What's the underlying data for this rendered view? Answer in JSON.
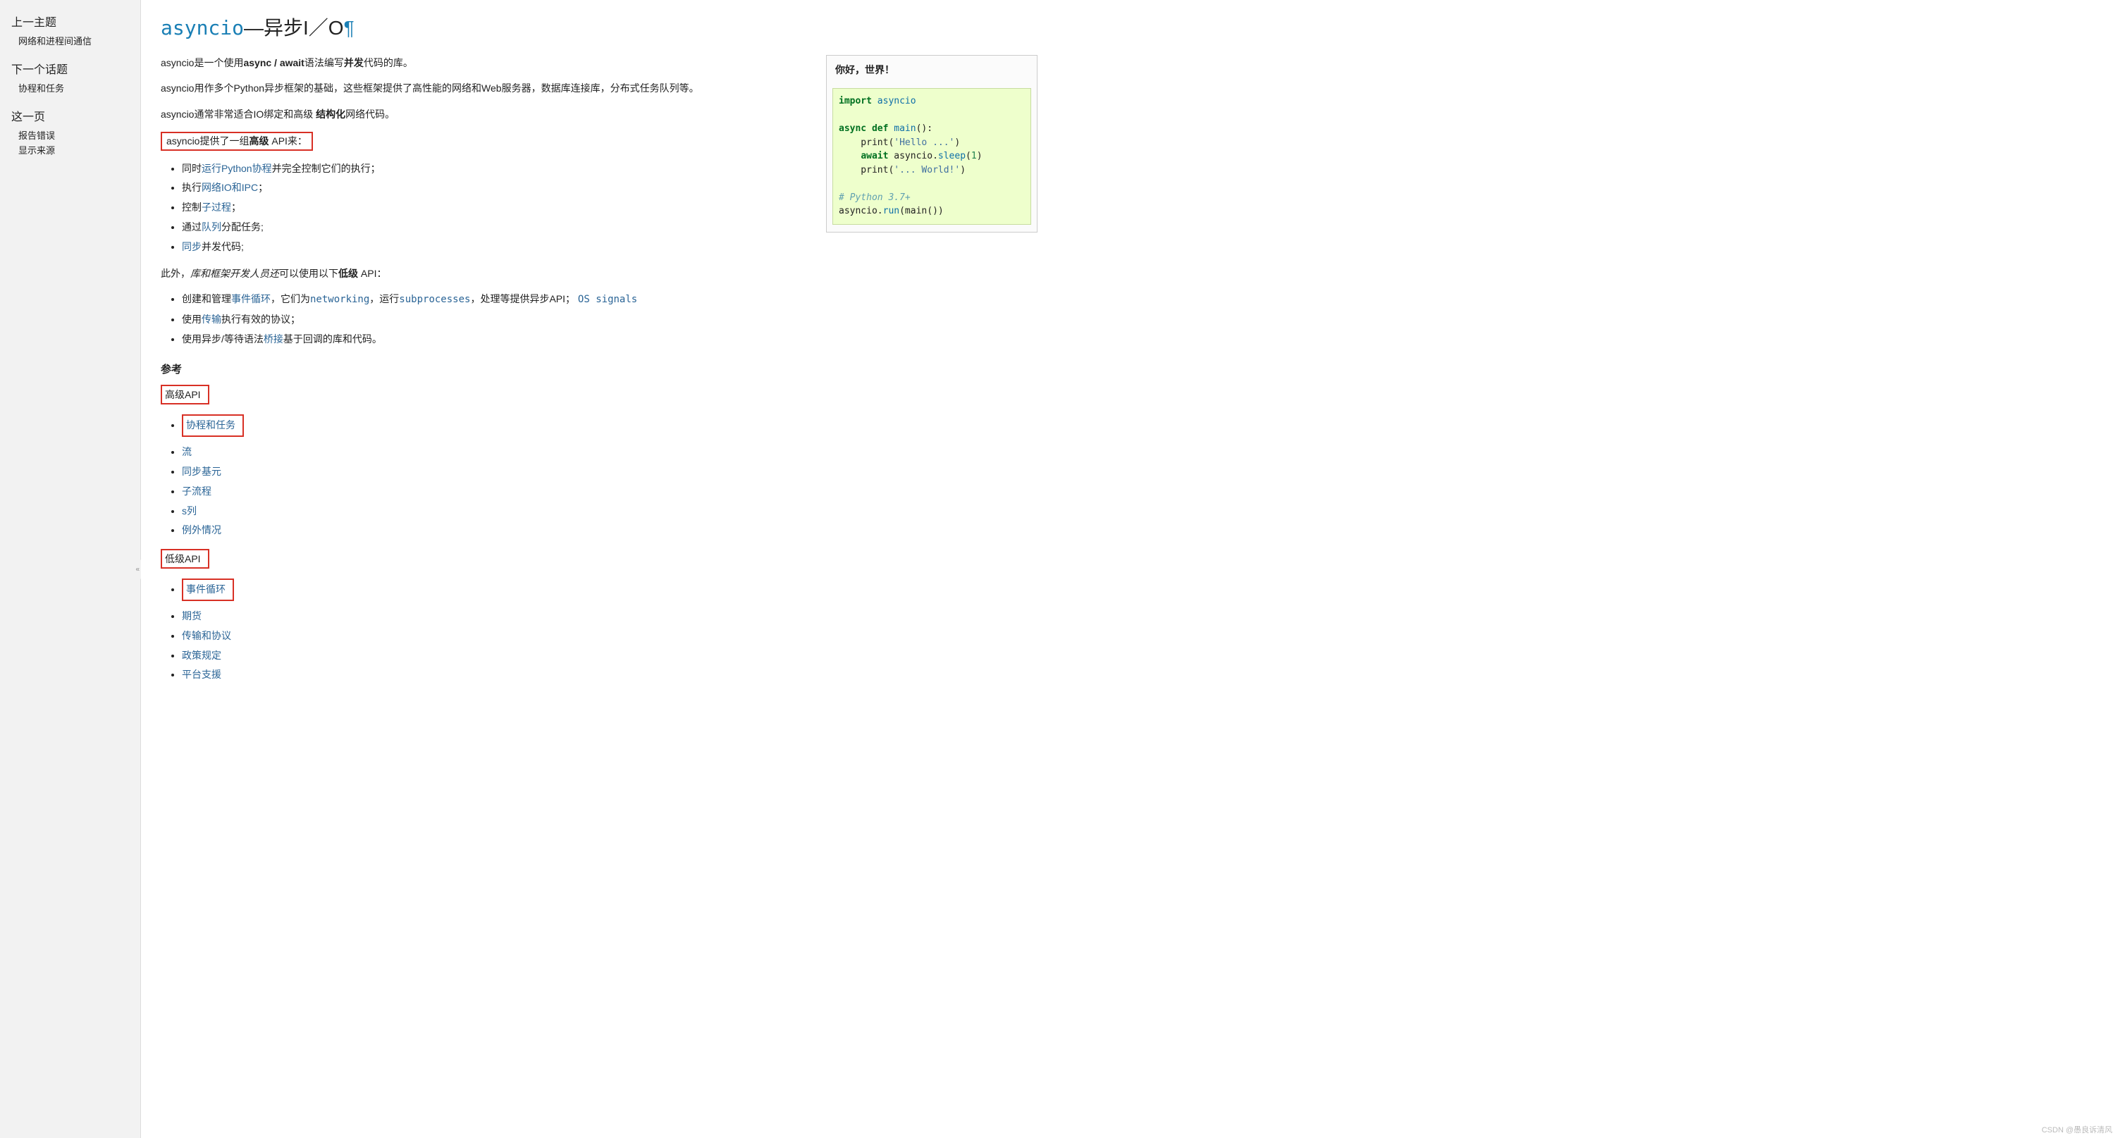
{
  "sidebar": {
    "prev": {
      "heading": "上一主题",
      "link": "网络和进程间通信"
    },
    "next": {
      "heading": "下一个话题",
      "link": "协程和任务"
    },
    "thispage": {
      "heading": "这一页",
      "report": "报告错误",
      "source": "显示来源"
    },
    "collapse": "«"
  },
  "title": {
    "code": "asyncio",
    "dash": "—异步I／O",
    "pilcrow": "¶"
  },
  "floatbox": {
    "hello": "你好，世界！",
    "code": {
      "l1a": "import",
      "l1b": "asyncio",
      "l2a": "async",
      "l2b": "def",
      "l2c": "main",
      "l2d": "():",
      "l3a": "    print(",
      "l3b": "'Hello ...'",
      "l3c": ")",
      "l4a": "    ",
      "l4b": "await",
      "l4c": " asyncio",
      "l4d": ".",
      "l4e": "sleep",
      "l4f": "(",
      "l4g": "1",
      "l4h": ")",
      "l5a": "    print(",
      "l5b": "'... World!'",
      "l5c": ")",
      "l6": "# Python 3.7+",
      "l7a": "asyncio",
      "l7b": ".",
      "l7c": "run",
      "l7d": "(main())"
    }
  },
  "p1": {
    "a": "asyncio是一个使用",
    "b": "async / await",
    "c": "语法编写",
    "d": "并发",
    "e": "代码的库。"
  },
  "p2": "asyncio用作多个Python异步框架的基础，这些框架提供了高性能的网络和Web服务器，数据库连接库，分布式任务队列等。",
  "p3": {
    "a": "asyncio通常非常适合IO绑定和高级 ",
    "b": "结构化",
    "c": "网络代码。"
  },
  "p4": {
    "a": "asyncio提供了一组",
    "b": "高级",
    "c": " API来："
  },
  "hl": {
    "i1": {
      "a": "同时",
      "b": "运行Python协程",
      "c": "并完全控制它们的执行；"
    },
    "i2": {
      "a": "执行",
      "b": "网络IO和IPC",
      "c": "；"
    },
    "i3": {
      "a": "控制",
      "b": "子过程",
      "c": "；"
    },
    "i4": {
      "a": "通过",
      "b": "队列",
      "c": "分配任务;"
    },
    "i5": {
      "a": "同步",
      "b": "并发代码;"
    }
  },
  "p5": {
    "a": "此外，",
    "b": "库和框架开发人员还",
    "c": "可以使用以下",
    "d": "低级",
    "e": " API："
  },
  "ll": {
    "i1": {
      "a": "创建和管理",
      "b": "事件循环",
      "c": "，它们为",
      "d": "networking",
      "e": "，运行",
      "f": "subprocesses",
      "g": "，处理等提供异步API；",
      "h": "OS signals"
    },
    "i2": {
      "a": "使用",
      "b": "传输",
      "c": "执行有效的协议；"
    },
    "i3": {
      "a": "使用异步/等待语法",
      "b": "桥接",
      "c": "基于回调的库和代码。"
    }
  },
  "ref": {
    "heading": "参考",
    "high": {
      "label": "高级API",
      "items": [
        "协程和任务",
        "流",
        "同步基元",
        "子流程",
        "s列",
        "例外情况"
      ]
    },
    "low": {
      "label": "低级API",
      "items": [
        "事件循环",
        "期货",
        "传输和协议",
        "政策规定",
        "平台支援"
      ]
    }
  },
  "watermark": "CSDN @愚良诉清风"
}
